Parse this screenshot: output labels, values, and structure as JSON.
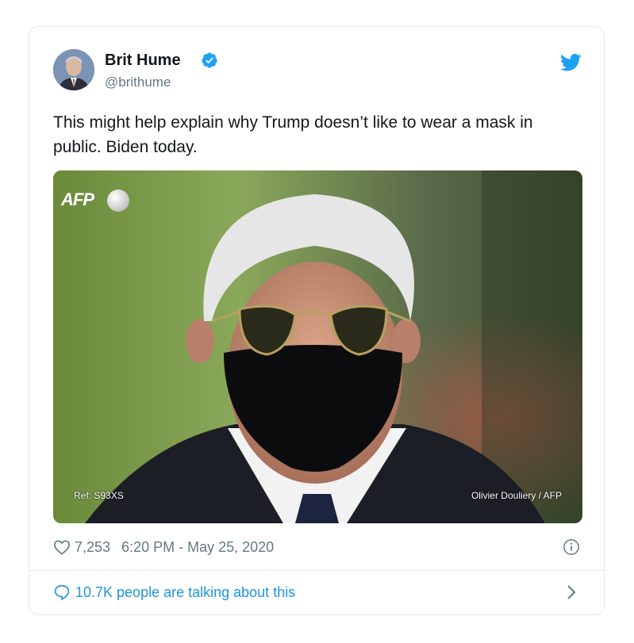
{
  "tweet": {
    "author_name": "Brit Hume",
    "author_handle": "@brithume",
    "text": "This might help explain why Trump doesn’t like to wear a mask in public. Biden today.",
    "photo": {
      "logo_text": "AFP",
      "ref": "Ref: S93XS",
      "credit": "Olivier Douliery / AFP"
    },
    "likes": "7,253",
    "timestamp": "6:20 PM - May 25, 2020",
    "talking": "10.7K people are talking about this"
  },
  "icons": {
    "verified": "verified-badge-icon",
    "brand": "twitter-bird-icon",
    "like": "heart-outline-icon",
    "info": "info-circle-icon",
    "reply": "speech-bubble-icon",
    "chevron": "chevron-right-icon"
  },
  "colors": {
    "accent": "#1da1f2",
    "link": "#1b95e0",
    "muted": "#657786",
    "text": "#14171a"
  }
}
